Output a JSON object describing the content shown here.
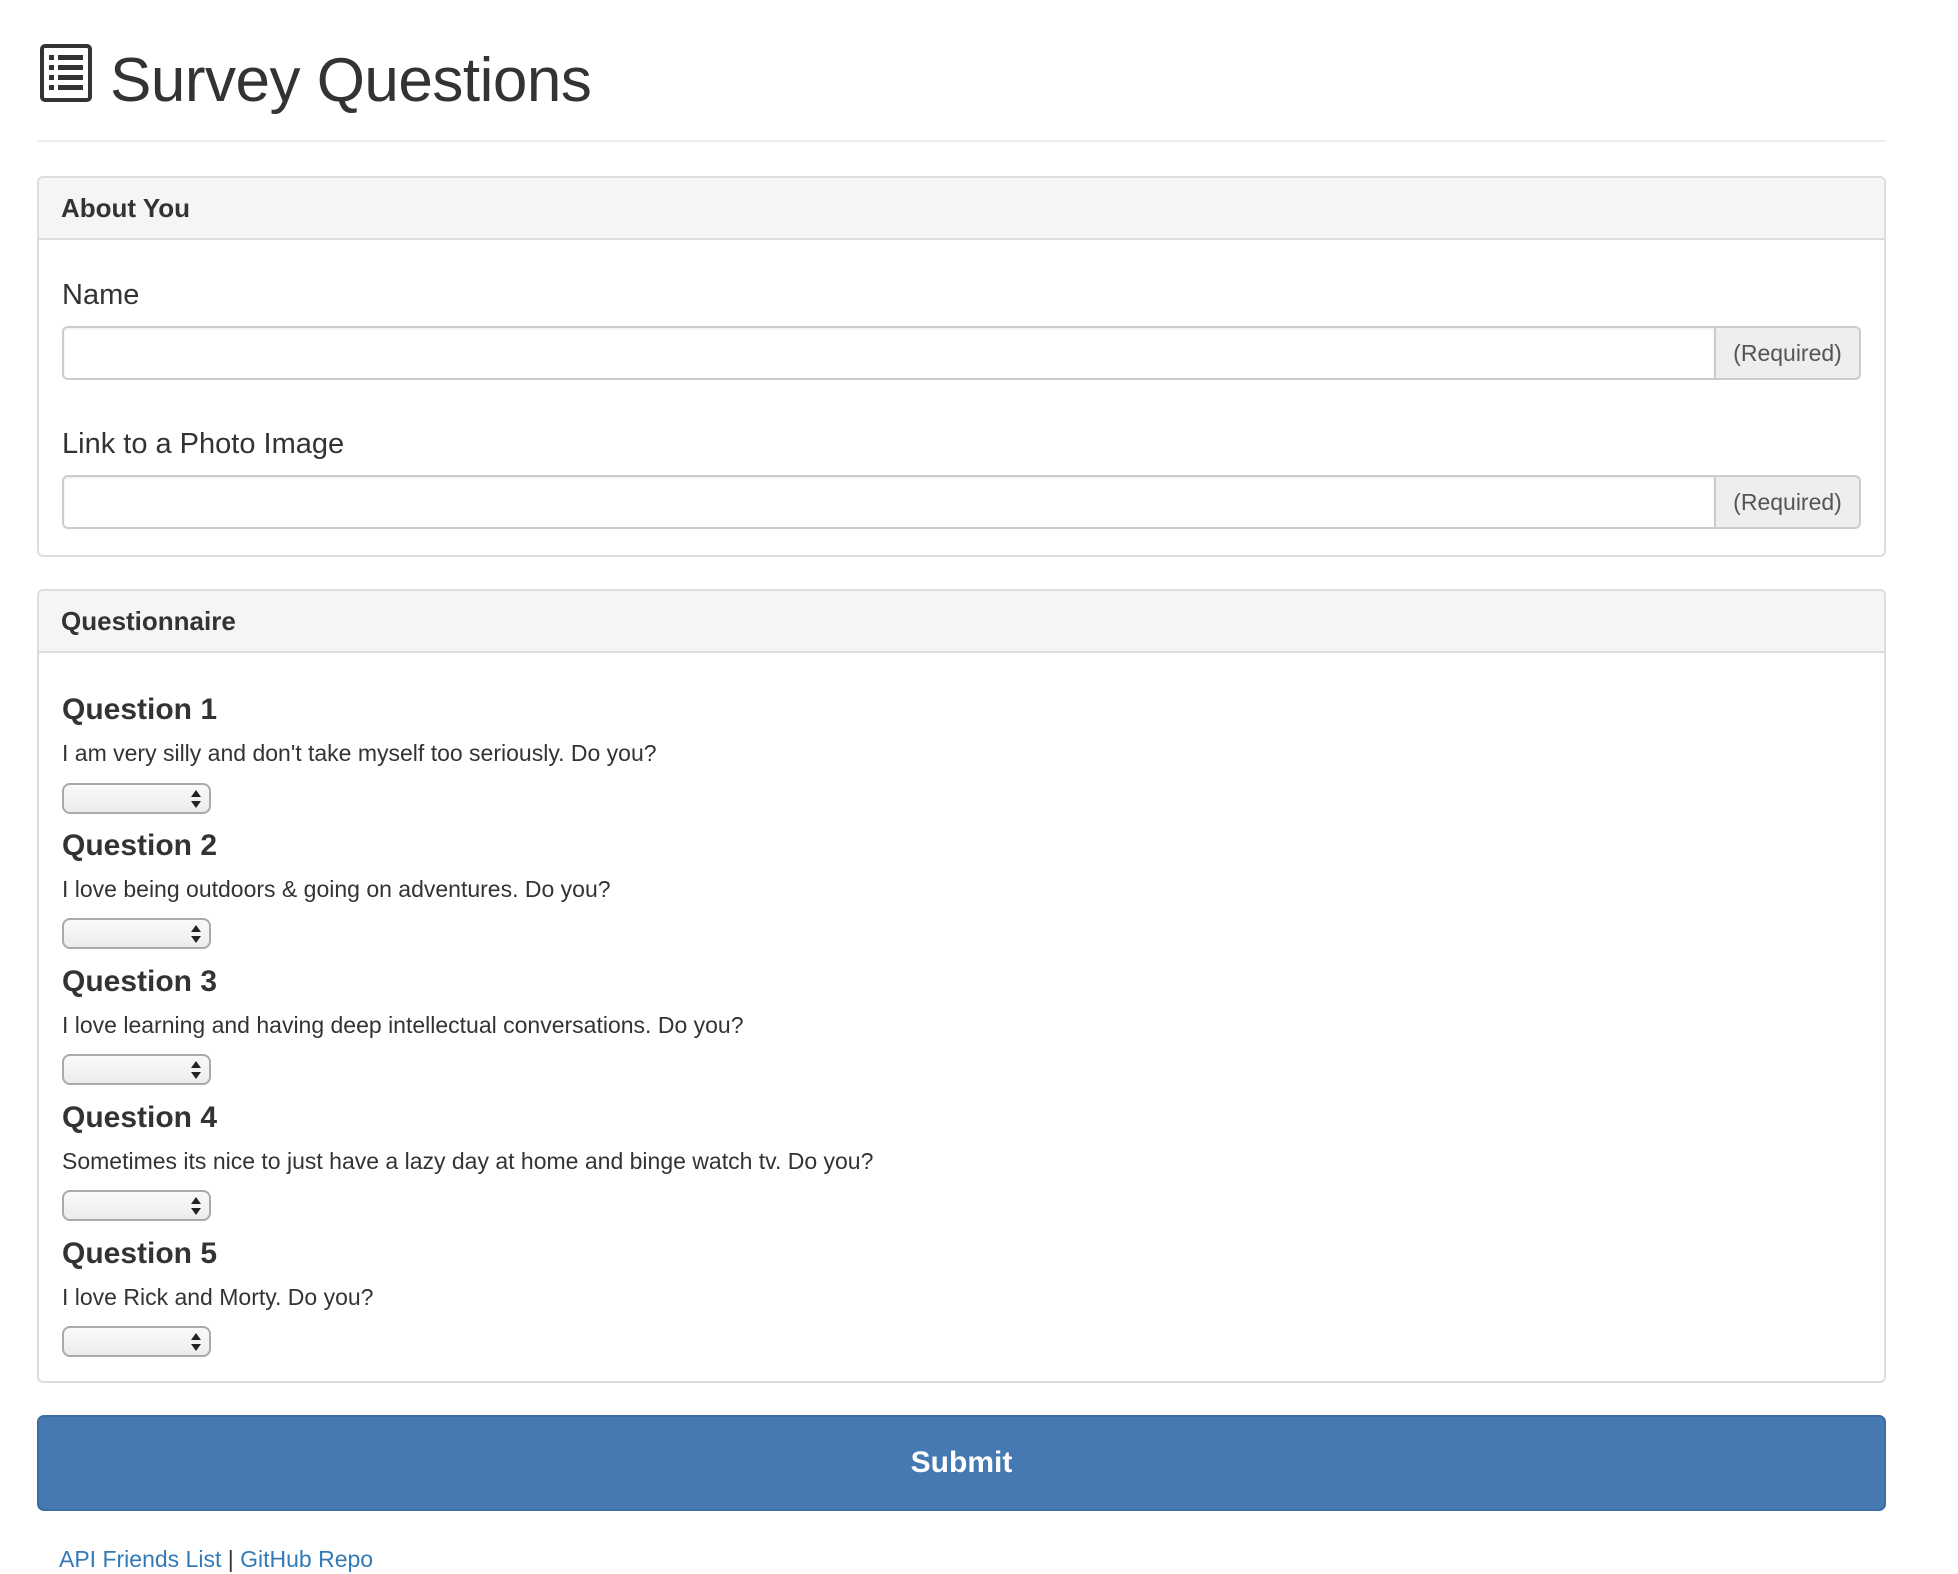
{
  "header": {
    "title": "Survey Questions",
    "icon": "list-alt-icon"
  },
  "about": {
    "heading": "About You",
    "name_label": "Name",
    "name_value": "",
    "name_addon": "(Required)",
    "photo_label": "Link to a Photo Image",
    "photo_value": "",
    "photo_addon": "(Required)"
  },
  "questionnaire": {
    "heading": "Questionnaire",
    "questions": [
      {
        "title": "Question 1",
        "text": "I am very silly and don't take myself too seriously. Do you?",
        "selected": ""
      },
      {
        "title": "Question 2",
        "text": "I love being outdoors & going on adventures. Do you?",
        "selected": ""
      },
      {
        "title": "Question 3",
        "text": "I love learning and having deep intellectual conversations. Do you?",
        "selected": ""
      },
      {
        "title": "Question 4",
        "text": "Sometimes its nice to just have a lazy day at home and binge watch tv. Do you?",
        "selected": ""
      },
      {
        "title": "Question 5",
        "text": "I love Rick and Morty. Do you?",
        "selected": ""
      }
    ]
  },
  "submit_label": "Submit",
  "footer": {
    "link1": "API Friends List",
    "separator": "|",
    "link2": "GitHub Repo"
  },
  "colors": {
    "primary": "#4679b2",
    "link": "#337ab7",
    "panel_heading_bg": "#f5f5f5",
    "border": "#dddddd"
  }
}
